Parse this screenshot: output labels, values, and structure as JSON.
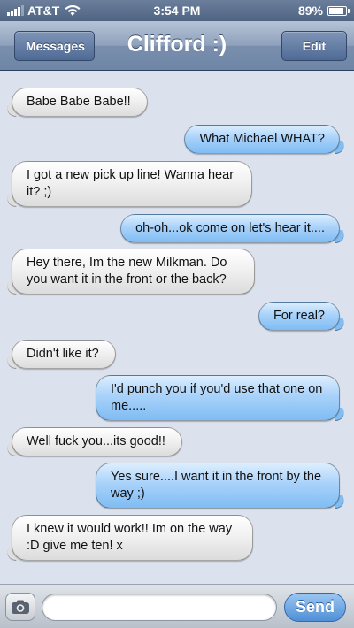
{
  "status_bar": {
    "carrier": "AT&T",
    "time": "3:54 PM",
    "battery_percent": "89%",
    "battery_level": 0.89,
    "signal_bars": 4,
    "wifi": true
  },
  "nav": {
    "back_label": "Messages",
    "title": "Clifford :)",
    "edit_label": "Edit"
  },
  "messages": [
    {
      "direction": "received",
      "text": "Babe Babe Babe!!"
    },
    {
      "direction": "sent",
      "text": "What Michael WHAT?"
    },
    {
      "direction": "received",
      "text": "I got a new pick up line! Wanna hear it? ;)"
    },
    {
      "direction": "sent",
      "text": "oh-oh...ok come on let's hear it...."
    },
    {
      "direction": "received",
      "text": "Hey there, Im the new Milkman. Do you want it in the front or the back?"
    },
    {
      "direction": "sent",
      "text": "For real?"
    },
    {
      "direction": "received",
      "text": "Didn't like it?"
    },
    {
      "direction": "sent",
      "text": "I'd punch you if you'd use that one on me....."
    },
    {
      "direction": "received",
      "text": "Well fuck you...its good!!"
    },
    {
      "direction": "sent",
      "text": "Yes sure....I want it in the front by the way ;)"
    },
    {
      "direction": "received",
      "text": "I knew it would work!! Im on the way :D give me ten! x"
    }
  ],
  "input_bar": {
    "text_value": "",
    "send_label": "Send",
    "camera_icon": "camera-icon"
  },
  "colors": {
    "sent_bubble": "#8ec6f5",
    "received_bubble": "#eeeeee",
    "nav_bar": "#7a8fae",
    "background": "#dbe2ed",
    "send_button": "#4f8fd6"
  }
}
